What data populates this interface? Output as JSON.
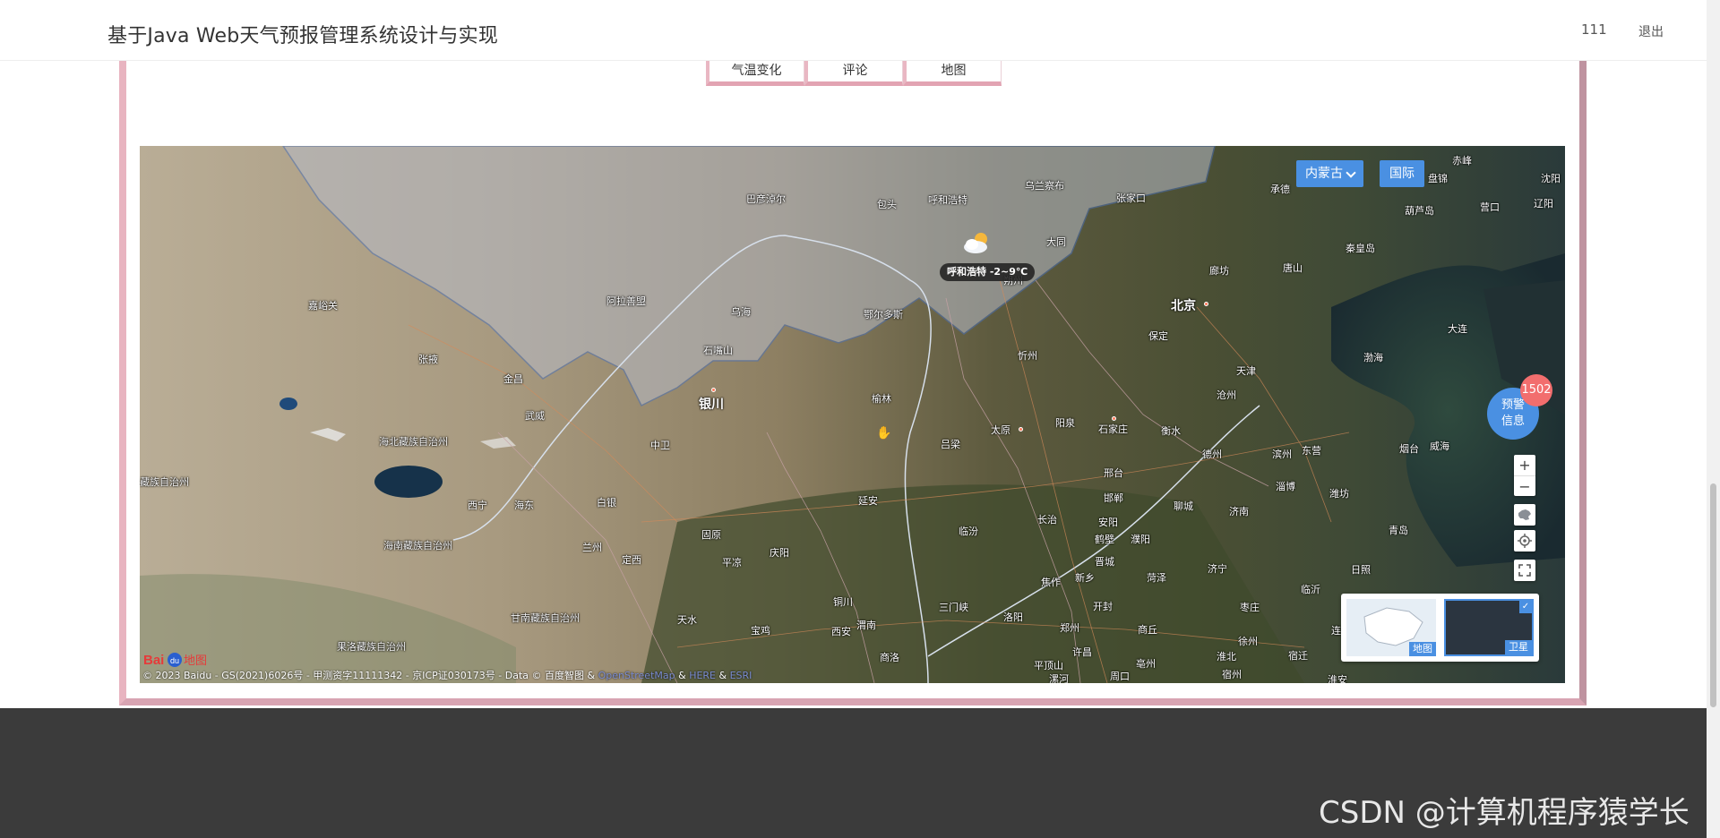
{
  "header": {
    "title": "基于Java Web天气预报管理系统设计与实现",
    "user": "111",
    "logout": "退出"
  },
  "tabs": [
    "气温变化",
    "评论",
    "地图"
  ],
  "map": {
    "region_select": "内蒙古",
    "intl_button": "国际",
    "warning": {
      "line1": "预警",
      "line2": "信息",
      "count": "1502"
    },
    "weather_label": "呼和浩特 -2~9℃",
    "zoom_in": "+",
    "zoom_out": "−",
    "maptype": {
      "standard": "地图",
      "satellite": "卫星",
      "check": "✓"
    },
    "logo": {
      "bai": "Bai",
      "du": "du",
      "map": "地图"
    },
    "copyright": {
      "main": "© 2023 Baidu - GS(2021)6026号 - 甲测资字11111342 - 京ICP证030173号 - Data © 百度智图 & ",
      "osm": "OpenStreetMap",
      "amp1": " & ",
      "here": "HERE",
      "amp2": " & ",
      "esri": "ESRI"
    },
    "cities": {
      "beijing": "北京",
      "tianjin": "天津",
      "yinchuan": "银川",
      "taiyuan": "太原",
      "shijiazhuang": "石家庄",
      "hohhot": "呼和浩特",
      "baotou": "包头",
      "bayannur": "巴彦淖尔",
      "ulanqab": "乌兰察布",
      "zhangjiakou": "张家口",
      "chengde": "承德",
      "chifeng": "赤峰",
      "jinzhou": "锦州",
      "panjin": "盘锦",
      "shenyang": "沈阳",
      "liaoyang": "辽阳",
      "huludao": "葫芦岛",
      "yingkou": "营口",
      "qinhuangdao": "秦皇岛",
      "tangshan": "唐山",
      "langfang": "廊坊",
      "baoding": "保定",
      "cangzhou": "沧州",
      "dalian": "大连",
      "bohai": "渤海",
      "datong": "大同",
      "shuozhou": "朔州",
      "xinzhou": "忻州",
      "yangquan": "阳泉",
      "hengshui": "衡水",
      "dezhou": "德州",
      "binzhou": "滨州",
      "dongying": "东营",
      "yantai": "烟台",
      "weihai": "威海",
      "zibo": "淄博",
      "weifang": "潍坊",
      "jinan": "济南",
      "liaocheng": "聊城",
      "xingtai": "邢台",
      "handan": "邯郸",
      "changzhi": "长治",
      "anyang": "安阳",
      "hebi": "鹤壁",
      "puyang": "濮阳",
      "qingdao": "青岛",
      "rizhao": "日照",
      "linyi": "临沂",
      "jining": "济宁",
      "heze": "菏泽",
      "zaozhuang": "枣庄",
      "xuzhou": "徐州",
      "suqian": "宿迁",
      "lianyungang": "连云港",
      "huaian": "淮安",
      "suzhou": "宿州",
      "huaibei": "淮北",
      "bozhou": "亳州",
      "shangqiu": "商丘",
      "kaifeng": "开封",
      "xinxiang": "新乡",
      "jiaozuo": "焦作",
      "zhengzhou": "郑州",
      "xuchang": "许昌",
      "luoyang": "洛阳",
      "pingdingshan": "平顶山",
      "luohe": "漯河",
      "zhoukou": "周口",
      "sanmenxia": "三门峡",
      "linfen": "临汾",
      "jincheng": "晋城",
      "lvliang": "吕梁",
      "yulin": "榆林",
      "ordos": "鄂尔多斯",
      "wuhai": "乌海",
      "shizuishan": "石嘴山",
      "alxa": "阿拉善盟",
      "zhongwei": "中卫",
      "yanan": "延安",
      "tongchuan": "铜川",
      "weinan": "渭南",
      "xian": "西安",
      "shangluo": "商洛",
      "baoji": "宝鸡",
      "tianshui": "天水",
      "pingliang": "平凉",
      "qingyang": "庆阳",
      "guyuan": "固原",
      "dingxi": "定西",
      "lanzhou": "兰州",
      "baiyin": "白银",
      "wuwei": "武威",
      "jinchang": "金昌",
      "zhangye": "张掖",
      "jiayuguan": "嘉峪关",
      "xining": "西宁",
      "haidong": "海东",
      "haibei": "海北藏族自治州",
      "hainan": "海南藏族自治州",
      "gannan": "甘南藏族自治州",
      "guoluo": "果洛藏族自治州",
      "haixi": "藏族自治州"
    }
  },
  "watermark": "CSDN @计算机程序猿学长"
}
